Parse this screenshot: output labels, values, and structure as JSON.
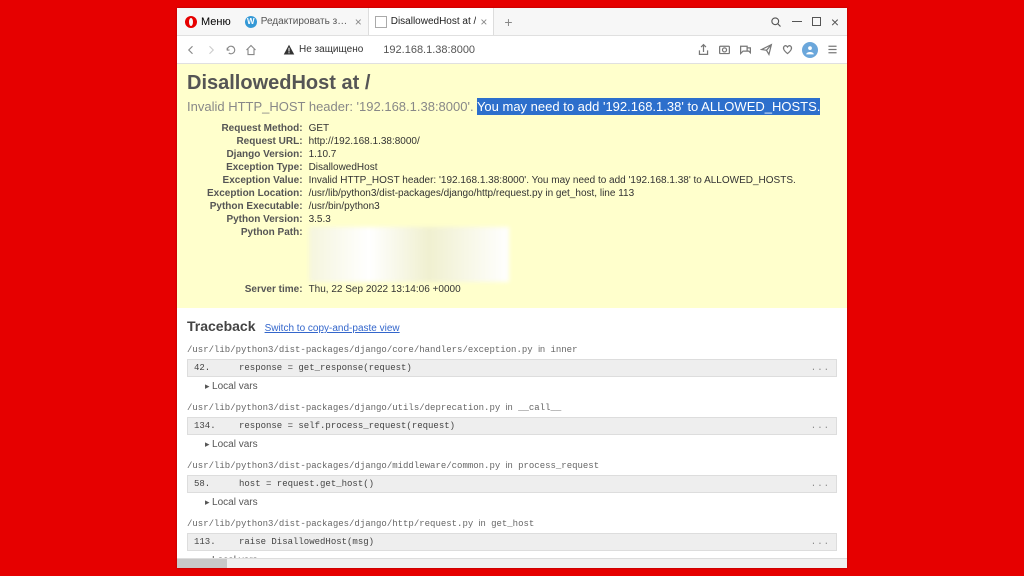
{
  "window": {
    "menu_label": "Меню"
  },
  "tabs": [
    {
      "label": "Редактировать запись \"Т..."
    },
    {
      "label": "DisallowedHost at /"
    }
  ],
  "address_bar": {
    "security_text": "Не защищено",
    "url": "192.168.1.38:8000"
  },
  "error": {
    "title": "DisallowedHost at /",
    "subhead_prefix": "Invalid HTTP_HOST header: '192.168.1.38:8000'. ",
    "subhead_highlight": "You may need to add '192.168.1.38' to ALLOWED_HOSTS.",
    "meta": {
      "request_method_label": "Request Method:",
      "request_method": "GET",
      "request_url_label": "Request URL:",
      "request_url": "http://192.168.1.38:8000/",
      "django_version_label": "Django Version:",
      "django_version": "1.10.7",
      "exception_type_label": "Exception Type:",
      "exception_type": "DisallowedHost",
      "exception_value_label": "Exception Value:",
      "exception_value": "Invalid HTTP_HOST header: '192.168.1.38:8000'. You may need to add '192.168.1.38' to ALLOWED_HOSTS.",
      "exception_location_label": "Exception Location:",
      "exception_location": "/usr/lib/python3/dist-packages/django/http/request.py in get_host, line 113",
      "python_executable_label": "Python Executable:",
      "python_executable": "/usr/bin/python3",
      "python_version_label": "Python Version:",
      "python_version": "3.5.3",
      "python_path_label": "Python Path:",
      "server_time_label": "Server time:",
      "server_time": "Thu, 22 Sep 2022 13:14:06 +0000"
    }
  },
  "traceback": {
    "heading": "Traceback",
    "switch_link": "Switch to copy-and-paste view",
    "local_vars_label": "Local vars",
    "frames": [
      {
        "file": "/usr/lib/python3/dist-packages/django/core/handlers/exception.py",
        "in_word": "in",
        "func": "inner",
        "lineno": "42.",
        "code": "response = get_response(request)"
      },
      {
        "file": "/usr/lib/python3/dist-packages/django/utils/deprecation.py",
        "in_word": "in",
        "func": "__call__",
        "lineno": "134.",
        "code": "response = self.process_request(request)"
      },
      {
        "file": "/usr/lib/python3/dist-packages/django/middleware/common.py",
        "in_word": "in",
        "func": "process_request",
        "lineno": "58.",
        "code": "host = request.get_host()"
      },
      {
        "file": "/usr/lib/python3/dist-packages/django/http/request.py",
        "in_word": "in",
        "func": "get_host",
        "lineno": "113.",
        "code": "raise DisallowedHost(msg)"
      }
    ]
  }
}
